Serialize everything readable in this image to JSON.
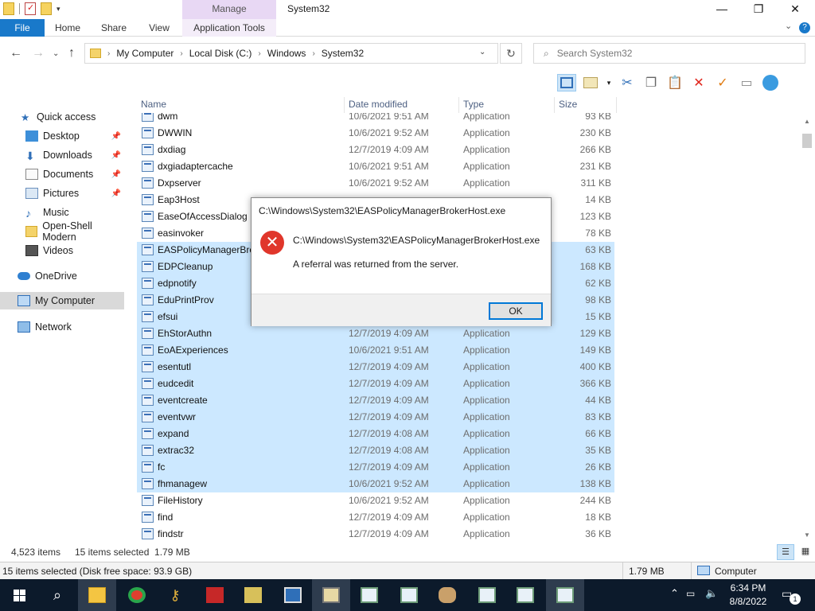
{
  "window": {
    "title": "System32",
    "manage_tab": "Manage",
    "min_icon": "minimize-icon",
    "max_icon": "maximize-icon",
    "close_icon": "close-icon"
  },
  "ribbon": {
    "tabs": [
      "File",
      "Home",
      "Share",
      "View",
      "Application Tools"
    ],
    "file_color": "#1979ca"
  },
  "address": {
    "crumbs": [
      "My Computer",
      "Local Disk (C:)",
      "Windows",
      "System32"
    ],
    "search_placeholder": "Search System32"
  },
  "sidebar": {
    "items": [
      {
        "label": "Quick access",
        "icon": "star-icon"
      },
      {
        "label": "Desktop",
        "icon": "desktop-icon",
        "pinned": true
      },
      {
        "label": "Downloads",
        "icon": "download-icon",
        "pinned": true
      },
      {
        "label": "Documents",
        "icon": "documents-icon",
        "pinned": true
      },
      {
        "label": "Pictures",
        "icon": "pictures-icon",
        "pinned": true
      },
      {
        "label": "Music",
        "icon": "music-icon"
      },
      {
        "label": "Open-Shell Modern",
        "icon": "folder-icon"
      },
      {
        "label": "Videos",
        "icon": "videos-icon"
      },
      {
        "label": "OneDrive",
        "icon": "cloud-icon"
      },
      {
        "label": "My Computer",
        "icon": "computer-icon",
        "selected": true
      },
      {
        "label": "Network",
        "icon": "network-icon"
      }
    ]
  },
  "columns": {
    "name": "Name",
    "date": "Date modified",
    "type": "Type",
    "size": "Size"
  },
  "files": [
    {
      "name": "dwm",
      "date": "10/6/2021 9:51 AM",
      "type": "Application",
      "size": "93 KB",
      "sel": false
    },
    {
      "name": "DWWIN",
      "date": "10/6/2021 9:52 AM",
      "type": "Application",
      "size": "230 KB",
      "sel": false
    },
    {
      "name": "dxdiag",
      "date": "12/7/2019 4:09 AM",
      "type": "Application",
      "size": "266 KB",
      "sel": false
    },
    {
      "name": "dxgiadaptercache",
      "date": "10/6/2021 9:51 AM",
      "type": "Application",
      "size": "231 KB",
      "sel": false
    },
    {
      "name": "Dxpserver",
      "date": "10/6/2021 9:52 AM",
      "type": "Application",
      "size": "311 KB",
      "sel": false
    },
    {
      "name": "Eap3Host",
      "date": "",
      "type": "",
      "size": "14 KB",
      "sel": false
    },
    {
      "name": "EaseOfAccessDialog",
      "date": "",
      "type": "",
      "size": "123 KB",
      "sel": false
    },
    {
      "name": "easinvoker",
      "date": "",
      "type": "",
      "size": "78 KB",
      "sel": false
    },
    {
      "name": "EASPolicyManagerBro",
      "date": "",
      "type": "",
      "size": "63 KB",
      "sel": true
    },
    {
      "name": "EDPCleanup",
      "date": "",
      "type": "",
      "size": "168 KB",
      "sel": true
    },
    {
      "name": "edpnotify",
      "date": "",
      "type": "",
      "size": "62 KB",
      "sel": true
    },
    {
      "name": "EduPrintProv",
      "date": "",
      "type": "",
      "size": "98 KB",
      "sel": true
    },
    {
      "name": "efsui",
      "date": "",
      "type": "",
      "size": "15 KB",
      "sel": true
    },
    {
      "name": "EhStorAuthn",
      "date": "12/7/2019 4:09 AM",
      "type": "Application",
      "size": "129 KB",
      "sel": true
    },
    {
      "name": "EoAExperiences",
      "date": "10/6/2021 9:51 AM",
      "type": "Application",
      "size": "149 KB",
      "sel": true
    },
    {
      "name": "esentutl",
      "date": "12/7/2019 4:09 AM",
      "type": "Application",
      "size": "400 KB",
      "sel": true
    },
    {
      "name": "eudcedit",
      "date": "12/7/2019 4:09 AM",
      "type": "Application",
      "size": "366 KB",
      "sel": true
    },
    {
      "name": "eventcreate",
      "date": "12/7/2019 4:09 AM",
      "type": "Application",
      "size": "44 KB",
      "sel": true
    },
    {
      "name": "eventvwr",
      "date": "12/7/2019 4:09 AM",
      "type": "Application",
      "size": "83 KB",
      "sel": true
    },
    {
      "name": "expand",
      "date": "12/7/2019 4:08 AM",
      "type": "Application",
      "size": "66 KB",
      "sel": true
    },
    {
      "name": "extrac32",
      "date": "12/7/2019 4:08 AM",
      "type": "Application",
      "size": "35 KB",
      "sel": true
    },
    {
      "name": "fc",
      "date": "12/7/2019 4:09 AM",
      "type": "Application",
      "size": "26 KB",
      "sel": true
    },
    {
      "name": "fhmanagew",
      "date": "10/6/2021 9:52 AM",
      "type": "Application",
      "size": "138 KB",
      "sel": true
    },
    {
      "name": "FileHistory",
      "date": "10/6/2021 9:52 AM",
      "type": "Application",
      "size": "244 KB",
      "sel": false
    },
    {
      "name": "find",
      "date": "12/7/2019 4:09 AM",
      "type": "Application",
      "size": "18 KB",
      "sel": false
    },
    {
      "name": "findstr",
      "date": "12/7/2019 4:09 AM",
      "type": "Application",
      "size": "36 KB",
      "sel": false
    }
  ],
  "status": {
    "items": "4,523 items",
    "selected": "15 items selected  1.79 MB",
    "details": "15 items selected (Disk free space: 93.9 GB)",
    "size": "1.79 MB",
    "location": "Computer"
  },
  "dialog": {
    "title": "C:\\Windows\\System32\\EASPolicyManagerBrokerHost.exe",
    "path": "C:\\Windows\\System32\\EASPolicyManagerBrokerHost.exe",
    "message": "A referral was returned from the server.",
    "ok": "OK",
    "error_symbol": "✕"
  },
  "taskbar": {
    "time": "6:34 PM",
    "date": "8/8/2022",
    "notification_count": "1"
  }
}
